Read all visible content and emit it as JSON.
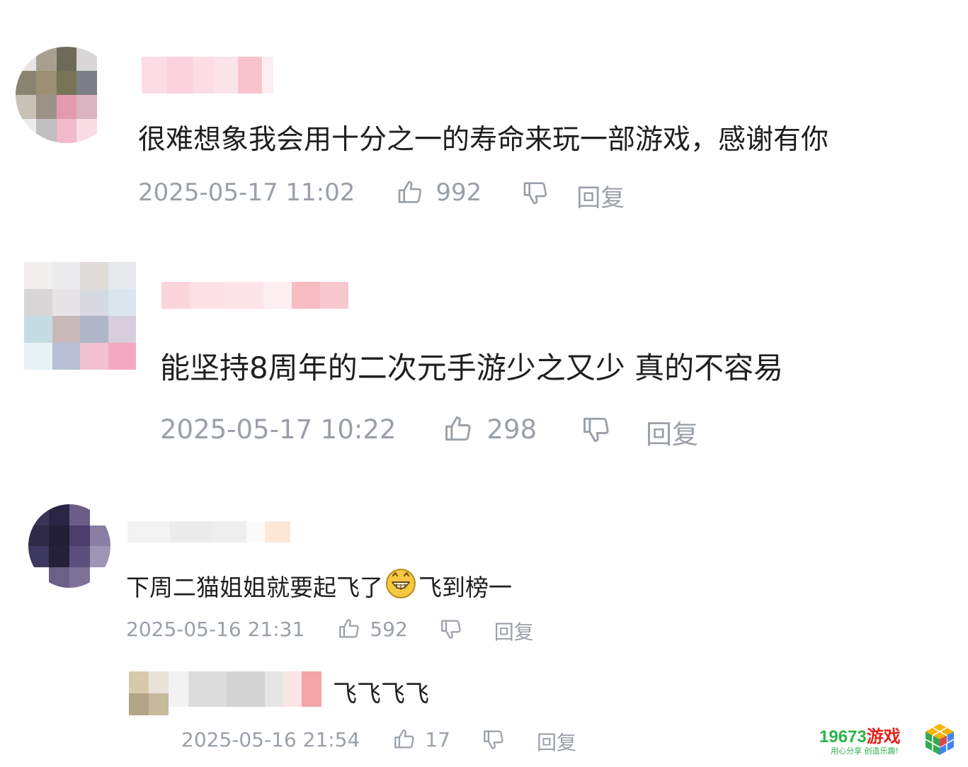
{
  "comments": [
    {
      "text": "很难想象我会用十分之一的寿命来玩一部游戏，感谢有你",
      "time": "2025-05-17 11:02",
      "likes": "992",
      "reply_label": "回复"
    },
    {
      "text": "能坚持8周年的二次元手游少之又少 真的不容易",
      "time": "2025-05-17 10:22",
      "likes": "298",
      "reply_label": "回复"
    },
    {
      "text_before": "下周二猫姐姐就要起飞了",
      "emoji": "grinning-emoji",
      "text_after": "飞到榜一",
      "time": "2025-05-16 21:31",
      "likes": "592",
      "reply_label": "回复"
    },
    {
      "text": "飞飞飞飞",
      "time": "2025-05-16 21:54",
      "likes": "17",
      "reply_label": "回复",
      "is_reply": true
    }
  ],
  "icons": {
    "like": "thumbs-up-icon",
    "dislike": "thumbs-down-icon"
  },
  "watermark": {
    "brand_number": "19673",
    "brand_cn": "游戏",
    "slogan": "用心分享  创造乐趣!"
  },
  "colors": {
    "meta": "#9aa0a8",
    "text": "#1f1f1f",
    "brand_green": "#2db34a",
    "brand_red": "#e2231a"
  }
}
